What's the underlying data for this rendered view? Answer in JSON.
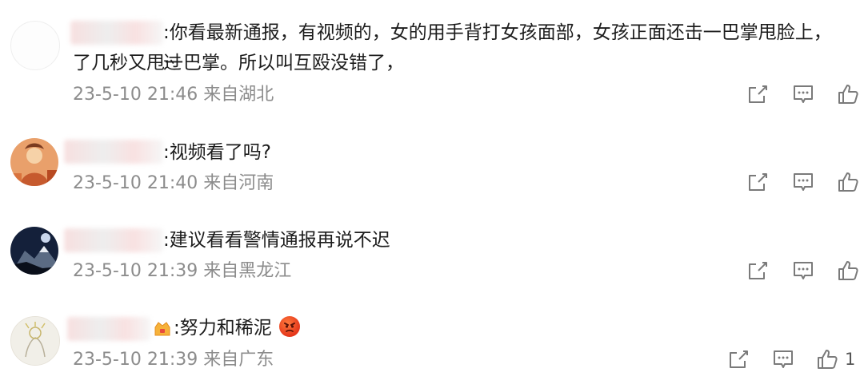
{
  "comments": [
    {
      "text": ":你看最新通报，有视频的，女的用手背打女孩面部，女孩正面还击一巴掌甩脸上，过",
      "text2": "了几秒又甩一巴掌。所以叫互殴没错了，",
      "time": "23-5-10 21:46",
      "location": "来自湖北",
      "avatar": "blank-avatar"
    },
    {
      "text": ":视频看了吗?",
      "time": "23-5-10 21:40",
      "location": "来自河南",
      "avatar": "orange-illustration-avatar"
    },
    {
      "text": ":建议看看警情通报再说不迟",
      "time": "23-5-10 21:39",
      "location": "来自黑龙江",
      "avatar": "mountain-night-avatar"
    },
    {
      "text": ":努力和稀泥",
      "time": "23-5-10 21:39",
      "location": "来自广东",
      "avatar": "sketch-avatar",
      "likes": "1"
    }
  ],
  "icons": {
    "share": "share-icon",
    "comment": "comment-icon",
    "like": "thumbs-up-icon",
    "badge": "vip-badge-icon",
    "emoji": "angry-emoji-icon"
  },
  "colors": {
    "meta": "#8c8c8c",
    "text": "#1c1c1c",
    "icon": "#7a7a7a"
  }
}
